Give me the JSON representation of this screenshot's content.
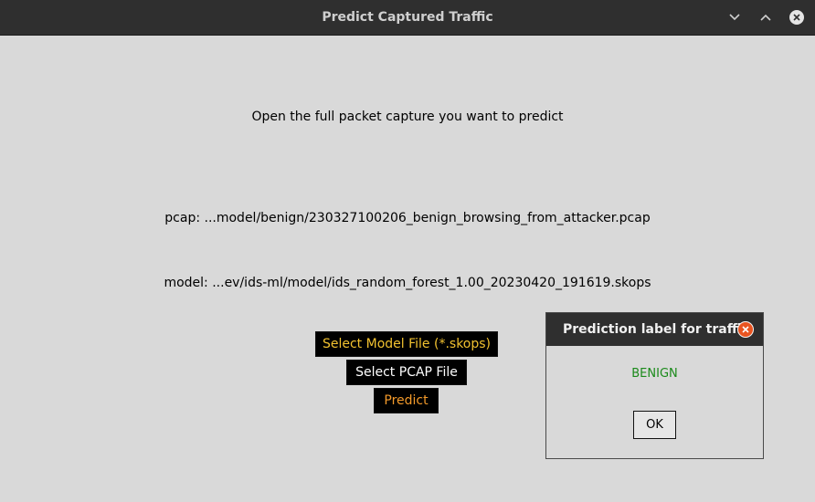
{
  "window": {
    "title": "Predict Captured Traffic",
    "controls": [
      "chevron-down-icon",
      "chevron-up-icon",
      "close-icon"
    ]
  },
  "main": {
    "instruction": "Open the full packet capture you want to predict",
    "pcap_path": "pcap: ...model/benign/230327100206_benign_browsing_from_attacker.pcap",
    "model_path": "model: ...ev/ids-ml/model/ids_random_forest_1.00_20230420_191619.skops",
    "buttons": {
      "select_model": "Select Model File (*.skops)",
      "select_pcap": "Select PCAP File",
      "predict": "Predict"
    }
  },
  "dialog": {
    "title": "Prediction label for traffic",
    "message": "BENIGN",
    "ok_label": "OK"
  },
  "colors": {
    "titlebar": "#2f2f2f",
    "background": "#d9d9d9",
    "select_model_text": "#f2c230",
    "predict_text": "#f39a2a",
    "result_text": "#1a8a1a",
    "dialog_close": "#e95420"
  }
}
